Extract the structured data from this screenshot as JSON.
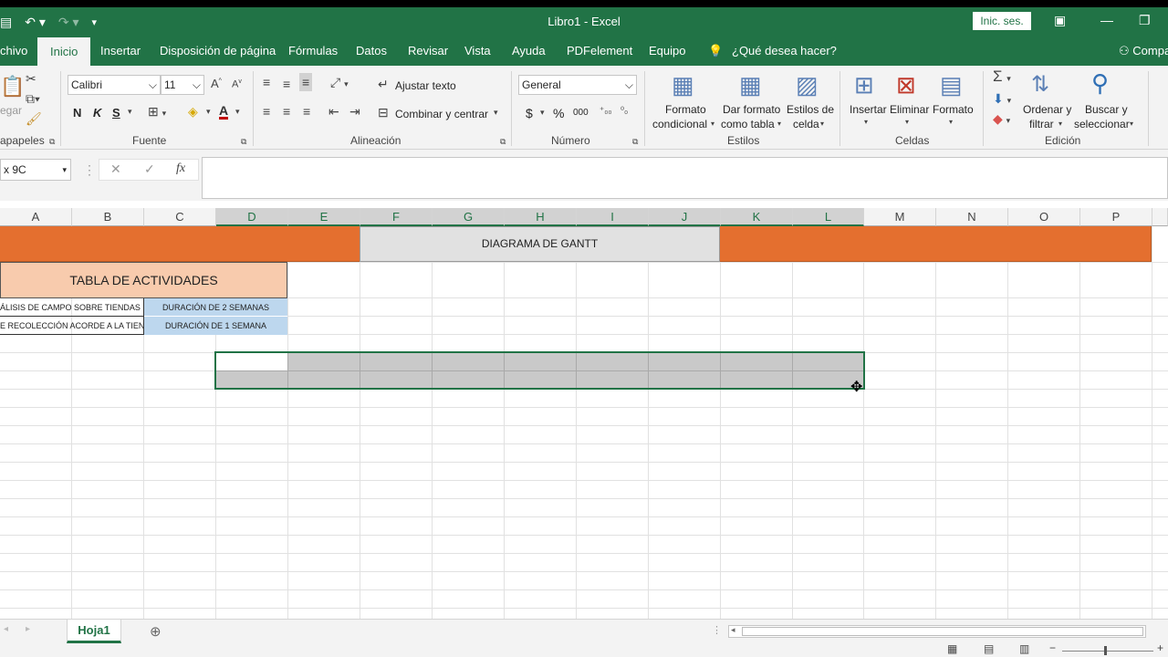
{
  "window": {
    "title": "Libro1  -  Excel",
    "signin": "Inic. ses."
  },
  "tabs": [
    "chivo",
    "Inicio",
    "Insertar",
    "Disposición de página",
    "Fórmulas",
    "Datos",
    "Revisar",
    "Vista",
    "Ayuda",
    "PDFelement",
    "Equipo",
    "¿Qué desea hacer?",
    "Compa"
  ],
  "ribbon": {
    "clipboard": {
      "paste": "egar",
      "label": "apapeles"
    },
    "font": {
      "name": "Calibri",
      "size": "11",
      "bold": "N",
      "italic": "K",
      "underline": "S",
      "label": "Fuente"
    },
    "alignment": {
      "wrap": "Ajustar texto",
      "merge": "Combinar y centrar",
      "label": "Alineación"
    },
    "number": {
      "format": "General",
      "currency": "$",
      "percent": "%",
      "thousands": "000",
      "label": "Número"
    },
    "styles": {
      "conditional_1": "Formato",
      "conditional_2": "condicional",
      "table_1": "Dar formato",
      "table_2": "como tabla",
      "cell_1": "Estilos de",
      "cell_2": "celda",
      "label": "Estilos"
    },
    "cells": {
      "insert": "Insertar",
      "delete": "Eliminar",
      "format": "Formato",
      "label": "Celdas"
    },
    "editing": {
      "sort_1": "Ordenar y",
      "sort_2": "filtrar",
      "find_1": "Buscar y",
      "find_2": "seleccionar",
      "label": "Edición"
    }
  },
  "formula_bar": {
    "name_box": "x 9C",
    "formula": ""
  },
  "sheet": {
    "columns": [
      "A",
      "B",
      "C",
      "D",
      "E",
      "F",
      "G",
      "H",
      "I",
      "J",
      "K",
      "L",
      "M",
      "N",
      "O",
      "P"
    ],
    "gantt_title": "DIAGRAMA DE GANTT",
    "activities_title": "TABLA DE ACTIVIDADES",
    "activity_1": "ÁLISIS DE CAMPO SOBRE TIENDAS DE ZA",
    "activity_2": "E RECOLECCIÓN ACORDE A LA TIENDA",
    "duration_1": "DURACIÓN DE 2 SEMANAS",
    "duration_2": "DURACIÓN DE 1 SEMANA"
  },
  "sheet_tabs": [
    "Hoja1"
  ],
  "colors": {
    "excel_green": "#217346",
    "orange_header": "#e46f2f",
    "peach": "#f8cbad",
    "light_blue": "#bdd7ee",
    "gray_fill": "#c9c9c9"
  }
}
